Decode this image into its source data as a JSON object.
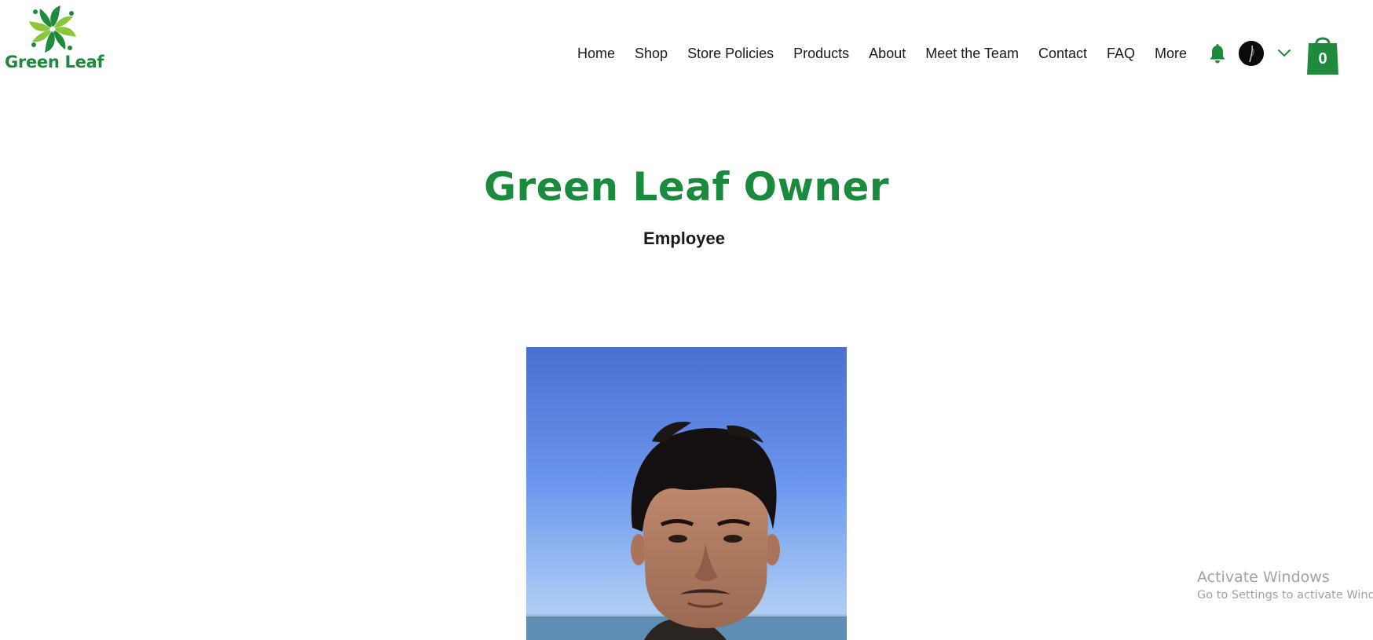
{
  "brand": {
    "name": "Green Leaf",
    "color": "#1f8a3c",
    "accent_light": "#8cc63f"
  },
  "nav": {
    "items": [
      {
        "label": "Home"
      },
      {
        "label": "Shop"
      },
      {
        "label": "Store Policies"
      },
      {
        "label": "Products"
      },
      {
        "label": "About"
      },
      {
        "label": "Meet the Team"
      },
      {
        "label": "Contact"
      },
      {
        "label": "FAQ"
      },
      {
        "label": "More"
      }
    ]
  },
  "header_icons": {
    "notifications": "bell-icon",
    "account": "avatar",
    "account_menu": "chevron-down-icon",
    "cart": "shopping-bag-icon"
  },
  "cart": {
    "count": "0"
  },
  "profile": {
    "title": "Green Leaf Owner",
    "role": "Employee",
    "title_color": "#1a8a3c"
  },
  "watermark": {
    "title": "Activate Windows",
    "subtitle": "Go to Settings to activate Windows."
  }
}
